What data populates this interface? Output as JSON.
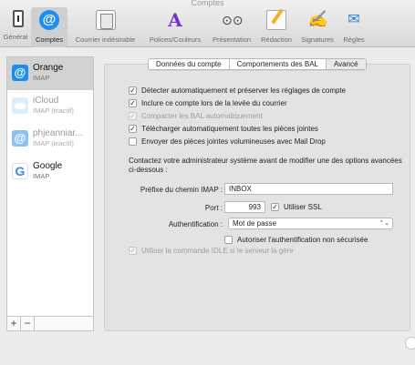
{
  "window": {
    "title": "Comptes"
  },
  "toolbar": {
    "items": [
      {
        "label": "Général"
      },
      {
        "label": "Comptes"
      },
      {
        "label": "Courrier indésirable"
      },
      {
        "label": "Polices/Couleurs"
      },
      {
        "label": "Présentation"
      },
      {
        "label": "Rédaction"
      },
      {
        "label": "Signatures"
      },
      {
        "label": "Règles"
      }
    ]
  },
  "sidebar": {
    "accounts": [
      {
        "name": "Orange",
        "sub": "IMAP"
      },
      {
        "name": "iCloud",
        "sub": "IMAP (inactif)"
      },
      {
        "name": "phjeanniar...",
        "sub": "IMAP (inactif)"
      },
      {
        "name": "Google",
        "sub": "IMAP"
      }
    ],
    "add_label": "+",
    "remove_label": "−"
  },
  "tabs": [
    {
      "label": "Données du compte"
    },
    {
      "label": "Comportements des BAL"
    },
    {
      "label": "Avancé"
    }
  ],
  "options": {
    "detect": {
      "label": "Détecter automatiquement et préserver les réglages de compte",
      "checked": true
    },
    "include": {
      "label": "Inclure ce compte lors de la levée du courrier",
      "checked": true
    },
    "compact": {
      "label": "Compacter les BAL automatiquement",
      "checked": true
    },
    "download": {
      "label": "Télécharger automatiquement toutes les pièces jointes",
      "checked": true
    },
    "maildrop": {
      "label": "Envoyer des pièces jointes volumineuses avec Mail Drop",
      "checked": false
    },
    "insecure": {
      "label": "Autoriser l'authentification non sécurisée",
      "checked": false
    },
    "idle": {
      "label": "Utiliser la commande IDLE si le serveur la gère",
      "checked": true
    }
  },
  "info_text": "Contactez votre administrateur système avant de modifier une des options avancées ci-dessous :",
  "imap_prefix": {
    "label": "Préfixe du chemin IMAP :",
    "value": "INBOX"
  },
  "port": {
    "label": "Port :",
    "value": "993"
  },
  "ssl": {
    "label": "Utiliser SSL",
    "checked": true
  },
  "auth": {
    "label": "Authentification :",
    "value": "Mot de passe"
  },
  "check_mark": "✓"
}
